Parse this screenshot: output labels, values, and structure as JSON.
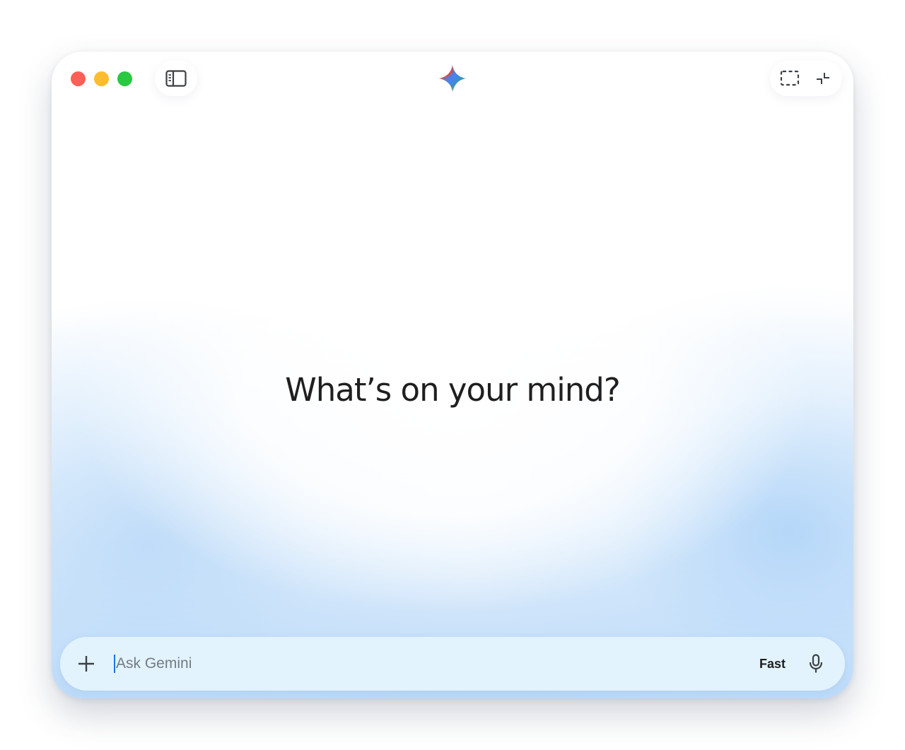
{
  "window": {
    "controls": [
      {
        "name": "close",
        "color": "#fe5f57"
      },
      {
        "name": "minimize",
        "color": "#febc2e"
      },
      {
        "name": "zoom",
        "color": "#28c840"
      }
    ]
  },
  "toolbar": {
    "sidebar_toggle_icon": "sidebar-panel-icon",
    "logo_icon": "gemini-sparkle-icon",
    "screen_capture_icon": "dashed-frame-icon",
    "collapse_icon": "collapse-arrows-icon"
  },
  "main": {
    "headline": "What’s on your mind?"
  },
  "composer": {
    "add_icon": "plus-icon",
    "input_value": "",
    "input_placeholder": "Ask Gemini",
    "mode_label": "Fast",
    "mic_icon": "microphone-icon"
  },
  "colors": {
    "accent_blue": "#1a73e8",
    "composer_bg": "#e2f3fd",
    "text_primary": "#1f1f1f",
    "placeholder": "#767a80"
  }
}
